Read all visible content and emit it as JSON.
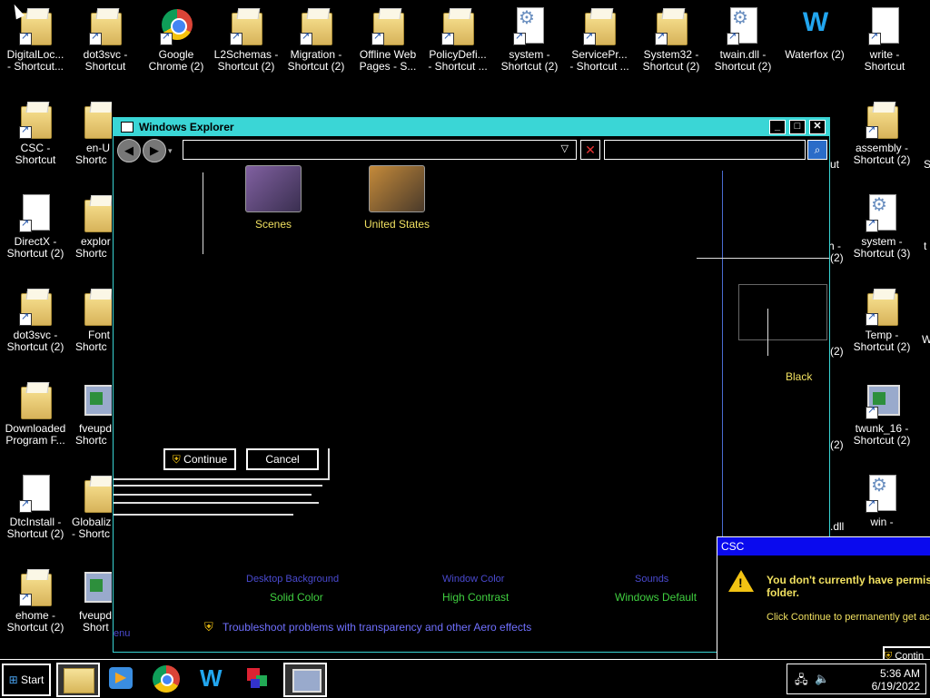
{
  "desktop": {
    "icons": [
      {
        "label1": "DigitalLoc...",
        "label2": "- Shortcut..."
      },
      {
        "label1": "dot3svc -",
        "label2": "Shortcut"
      },
      {
        "label1": "Google",
        "label2": "Chrome (2)"
      },
      {
        "label1": "L2Schemas -",
        "label2": "Shortcut (2)"
      },
      {
        "label1": "Migration -",
        "label2": "Shortcut (2)"
      },
      {
        "label1": "Offline Web",
        "label2": "Pages - S..."
      },
      {
        "label1": "PolicyDefi...",
        "label2": "- Shortcut ..."
      },
      {
        "label1": "system -",
        "label2": "Shortcut (2)"
      },
      {
        "label1": "ServicePr...",
        "label2": "- Shortcut ..."
      },
      {
        "label1": "System32 -",
        "label2": "Shortcut (2)"
      },
      {
        "label1": "twain.dll -",
        "label2": "Shortcut (2)"
      },
      {
        "label1": "Waterfox (2)",
        "label2": ""
      },
      {
        "label1": "write -",
        "label2": "Shortcut"
      },
      {
        "label1": "CSC -",
        "label2": "Shortcut"
      },
      {
        "label1": "DirectX -",
        "label2": "Shortcut (2)"
      },
      {
        "label1": "dot3svc -",
        "label2": "Shortcut (2)"
      },
      {
        "label1": "Downloaded",
        "label2": "Program F..."
      },
      {
        "label1": "DtcInstall -",
        "label2": "Shortcut (2)"
      },
      {
        "label1": "ehome -",
        "label2": "Shortcut (2)"
      },
      {
        "label1": "en-U",
        "label2": "Shortc"
      },
      {
        "label1": "explor",
        "label2": "Shortc"
      },
      {
        "label1": "Font",
        "label2": "Shortc"
      },
      {
        "label1": "fveupd",
        "label2": "Shortc"
      },
      {
        "label1": "Globaliz",
        "label2": "- Shortc"
      },
      {
        "label1": "fveupd",
        "label2": "Short"
      },
      {
        "label1": "assembly -",
        "label2": "Shortcut (2)"
      },
      {
        "label1": "system -",
        "label2": "Shortcut (3)"
      },
      {
        "label1": "Temp -",
        "label2": "Shortcut (2)"
      },
      {
        "label1": "twunk_16 -",
        "label2": "Shortcut (2)"
      },
      {
        "label1": "win -",
        "label2": ""
      }
    ],
    "peek_labels": {
      "ut": "ut",
      "h": "h -",
      "two_a": "(2)",
      "two_b": "(2)",
      "two_c": "(2)",
      "dll": ".dll",
      "s": "S",
      "t": "t",
      "w": "W",
      "enu": "enu"
    }
  },
  "explorer": {
    "title": "Windows Explorer",
    "address_value": "",
    "search_value": "",
    "themes": [
      {
        "label": "Scenes"
      },
      {
        "label": "United States"
      }
    ],
    "continue_label": "Continue",
    "cancel_label": "Cancel",
    "black_label": "Black",
    "bottom_links_faded": [
      "Desktop Background",
      "Window Color",
      "Sounds"
    ],
    "bottom_links": [
      "Solid Color",
      "High Contrast",
      "Windows Default"
    ],
    "troubleshoot": "Troubleshoot problems with transparency and other Aero effects"
  },
  "csc_dialog": {
    "title": "CSC",
    "message_line1": "You don't currently have permis",
    "message_line2": "folder.",
    "sub": "Click Continue to permanently get acc",
    "button_partial": "Contin"
  },
  "taskbar": {
    "start_label": "Start",
    "time": "5:36 AM",
    "date": "6/19/2022"
  },
  "colors": {
    "accent_cyan": "#3ad6d6",
    "link_yellow": "#f0e060",
    "link_green": "#40d040",
    "link_violet": "#7070ff",
    "dialog_title_blue": "#0a0aee"
  }
}
